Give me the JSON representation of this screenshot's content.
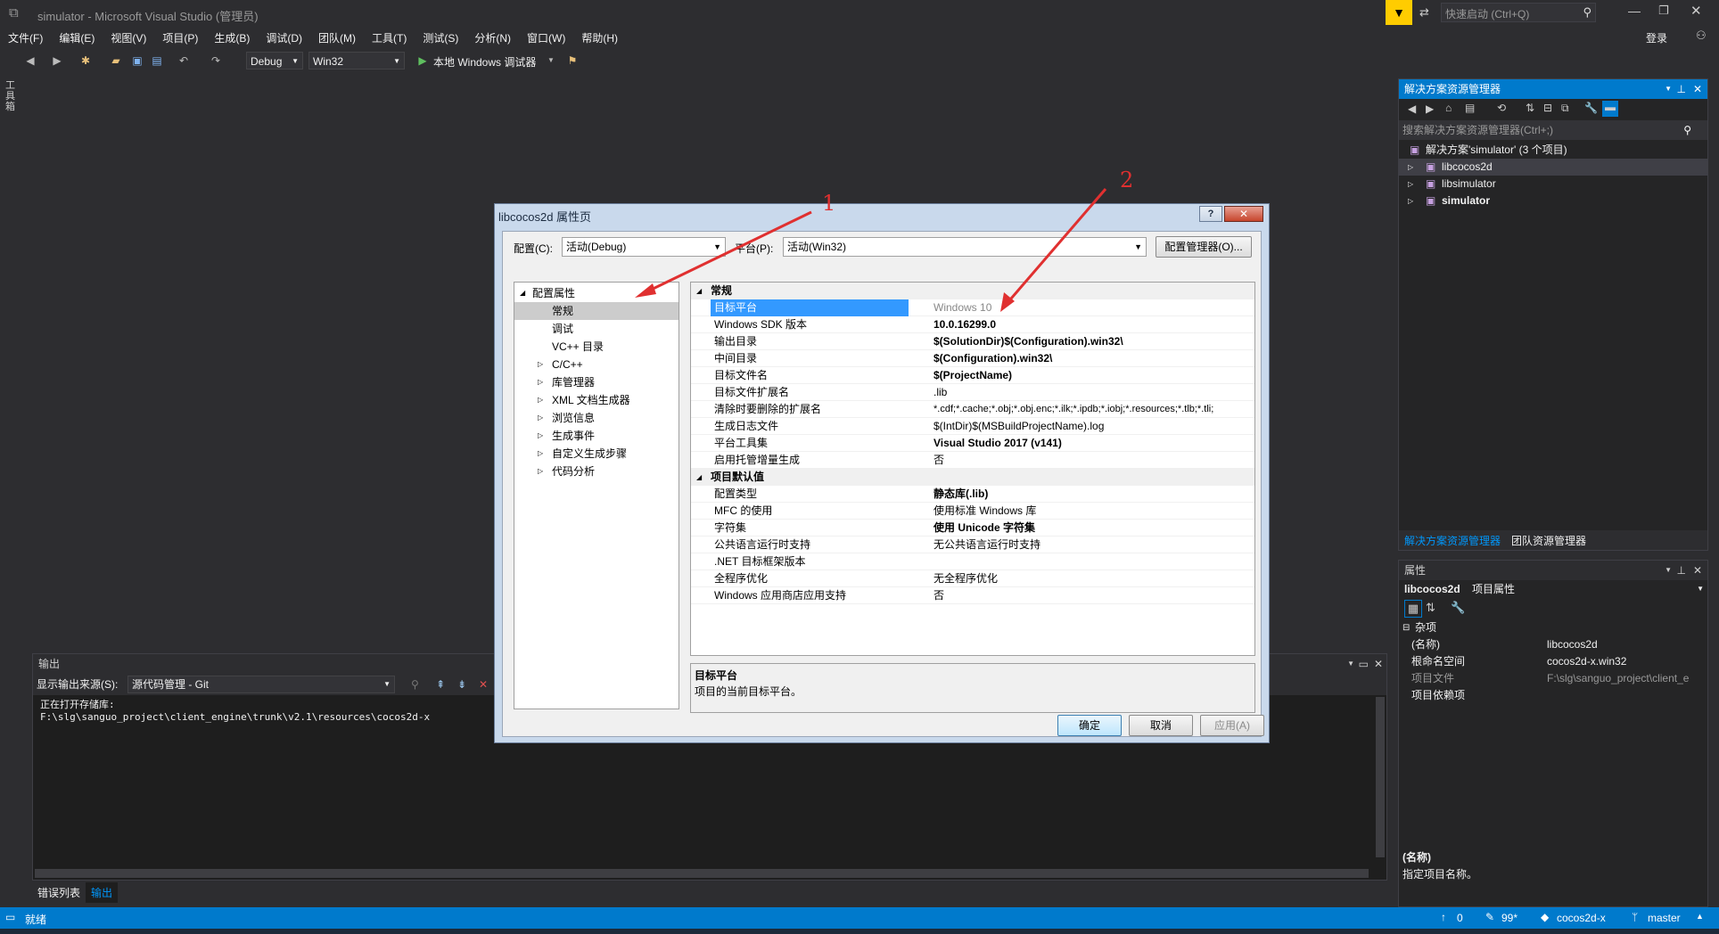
{
  "window": {
    "title": "simulator - Microsoft Visual Studio (管理员)",
    "quick_launch_placeholder": "快速启动 (Ctrl+Q)",
    "login_label": "登录"
  },
  "menu": [
    "文件(F)",
    "编辑(E)",
    "视图(V)",
    "项目(P)",
    "生成(B)",
    "调试(D)",
    "团队(M)",
    "工具(T)",
    "测试(S)",
    "分析(N)",
    "窗口(W)",
    "帮助(H)"
  ],
  "toolbar": {
    "config": "Debug",
    "platform": "Win32",
    "run_label": "本地 Windows 调试器"
  },
  "side_strip_label": "工具箱",
  "solution_explorer": {
    "title": "解决方案资源管理器",
    "search_placeholder": "搜索解决方案资源管理器(Ctrl+;)",
    "solution_label": "解决方案'simulator' (3 个项目)",
    "projects": [
      "libcocos2d",
      "libsimulator",
      "simulator"
    ],
    "tabs": [
      "解决方案资源管理器",
      "团队资源管理器"
    ]
  },
  "properties": {
    "title": "属性",
    "object_name": "libcocos2d",
    "object_type": "项目属性",
    "section": "杂项",
    "rows": [
      {
        "k": "(名称)",
        "v": "libcocos2d"
      },
      {
        "k": "根命名空间",
        "v": "cocos2d-x.win32"
      },
      {
        "k": "项目文件",
        "v": "F:\\slg\\sanguo_project\\client_e"
      },
      {
        "k": "项目依赖项",
        "v": ""
      }
    ],
    "desc_title": "(名称)",
    "desc_text": "指定项目名称。"
  },
  "output": {
    "title": "输出",
    "source_label": "显示输出来源(S):",
    "source_value": "源代码管理 - Git",
    "lines": [
      "正在打开存储库:",
      "F:\\slg\\sanguo_project\\client_engine\\trunk\\v2.1\\resources\\cocos2d-x"
    ],
    "tabs": [
      "错误列表",
      "输出"
    ]
  },
  "statusbar": {
    "ready": "就绪",
    "up_count": "0",
    "edit_count": "99*",
    "repo": "cocos2d-x",
    "branch": "master"
  },
  "dialog": {
    "title": "libcocos2d 属性页",
    "config_label": "配置(C):",
    "config_value": "活动(Debug)",
    "platform_label": "平台(P):",
    "platform_value": "活动(Win32)",
    "config_manager": "配置管理器(O)...",
    "tree": {
      "root": "配置属性",
      "items": [
        {
          "label": "常规",
          "expand": false,
          "selected": true
        },
        {
          "label": "调试",
          "expand": false,
          "selected": false
        },
        {
          "label": "VC++ 目录",
          "expand": false,
          "selected": false
        },
        {
          "label": "C/C++",
          "expand": true,
          "selected": false
        },
        {
          "label": "库管理器",
          "expand": true,
          "selected": false
        },
        {
          "label": "XML 文档生成器",
          "expand": true,
          "selected": false
        },
        {
          "label": "浏览信息",
          "expand": true,
          "selected": false
        },
        {
          "label": "生成事件",
          "expand": true,
          "selected": false
        },
        {
          "label": "自定义生成步骤",
          "expand": true,
          "selected": false
        },
        {
          "label": "代码分析",
          "expand": true,
          "selected": false
        }
      ]
    },
    "grid": {
      "sections": [
        {
          "title": "常规",
          "rows": [
            {
              "k": "目标平台",
              "v": "Windows 10",
              "style": "gray",
              "selected": true
            },
            {
              "k": "Windows SDK 版本",
              "v": "10.0.16299.0",
              "style": "bold"
            },
            {
              "k": "输出目录",
              "v": "$(SolutionDir)$(Configuration).win32\\",
              "style": "bold"
            },
            {
              "k": "中间目录",
              "v": "$(Configuration).win32\\",
              "style": "bold"
            },
            {
              "k": "目标文件名",
              "v": "$(ProjectName)",
              "style": "bold"
            },
            {
              "k": "目标文件扩展名",
              "v": ".lib",
              "style": ""
            },
            {
              "k": "清除时要删除的扩展名",
              "v": "*.cdf;*.cache;*.obj;*.obj.enc;*.ilk;*.ipdb;*.iobj;*.resources;*.tlb;*.tli;",
              "style": ""
            },
            {
              "k": "生成日志文件",
              "v": "$(IntDir)$(MSBuildProjectName).log",
              "style": ""
            },
            {
              "k": "平台工具集",
              "v": "Visual Studio 2017 (v141)",
              "style": "bold"
            },
            {
              "k": "启用托管增量生成",
              "v": "否",
              "style": ""
            }
          ]
        },
        {
          "title": "项目默认值",
          "rows": [
            {
              "k": "配置类型",
              "v": "静态库(.lib)",
              "style": "bold"
            },
            {
              "k": "MFC 的使用",
              "v": "使用标准 Windows 库",
              "style": ""
            },
            {
              "k": "字符集",
              "v": "使用 Unicode 字符集",
              "style": "bold"
            },
            {
              "k": "公共语言运行时支持",
              "v": "无公共语言运行时支持",
              "style": ""
            },
            {
              "k": ".NET 目标框架版本",
              "v": "",
              "style": ""
            },
            {
              "k": "全程序优化",
              "v": "无全程序优化",
              "style": ""
            },
            {
              "k": "Windows 应用商店应用支持",
              "v": "否",
              "style": ""
            }
          ]
        }
      ]
    },
    "desc_title": "目标平台",
    "desc_text": "项目的当前目标平台。",
    "buttons": {
      "ok": "确定",
      "cancel": "取消",
      "apply": "应用(A)"
    }
  },
  "annotations": {
    "label1": "1",
    "label2": "2",
    "color": "#e03030"
  }
}
